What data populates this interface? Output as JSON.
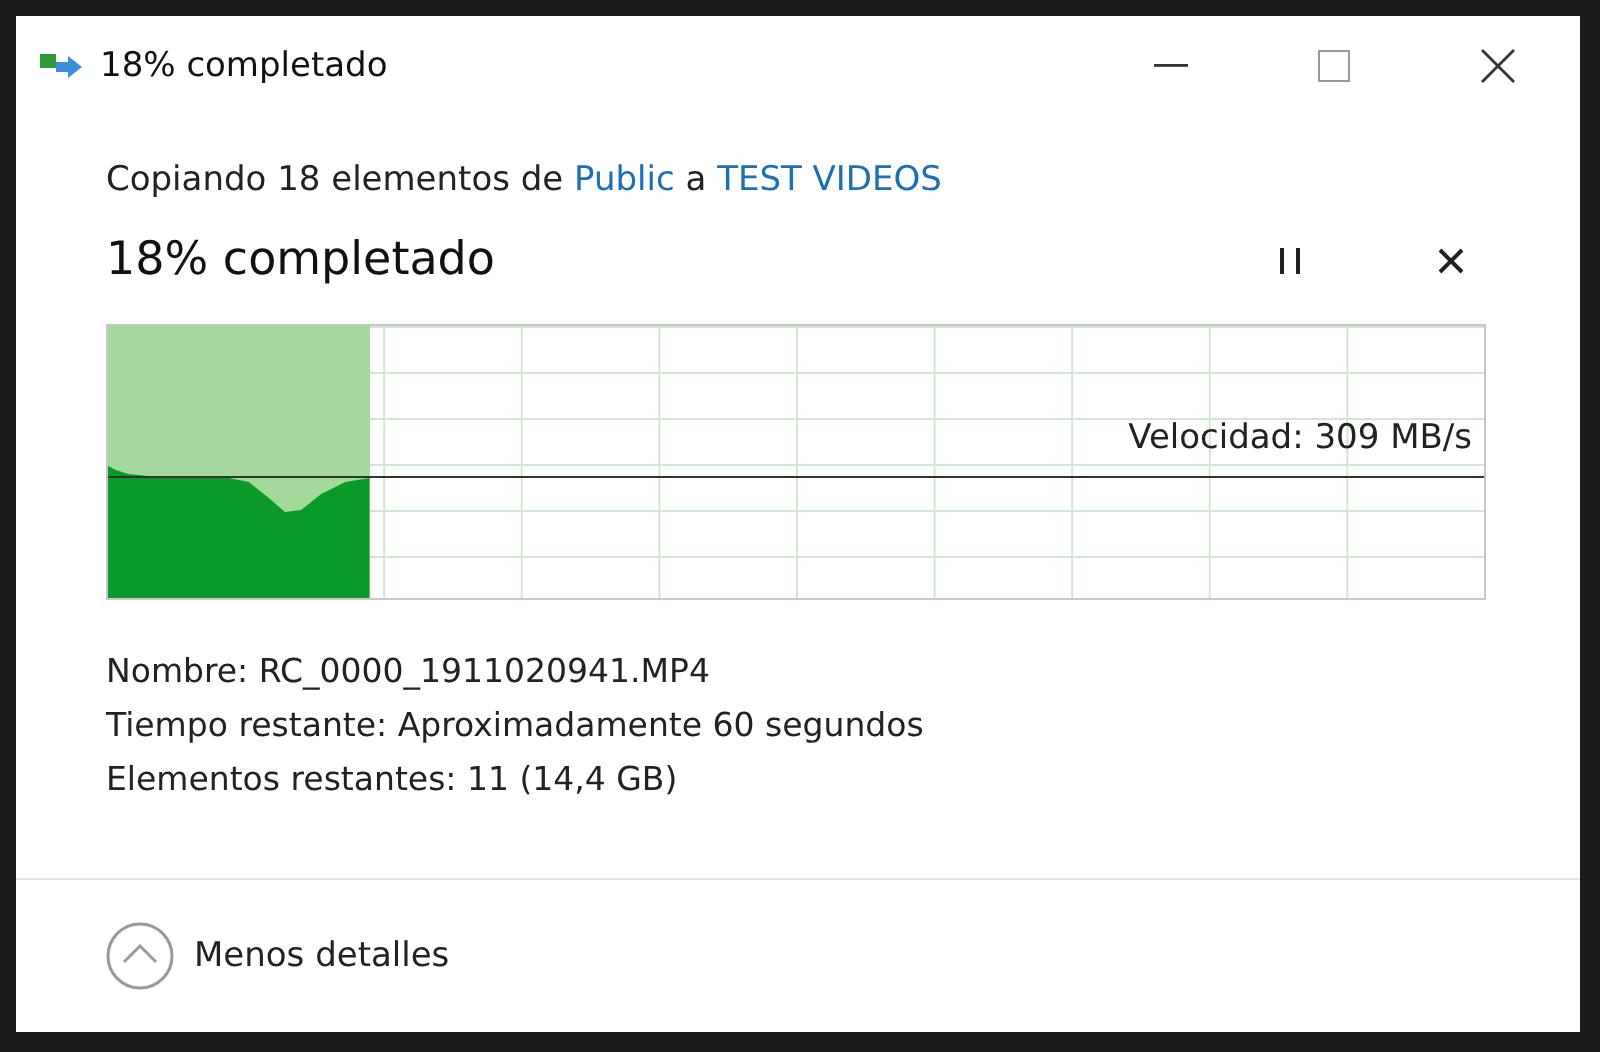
{
  "window": {
    "title": "18% completado",
    "controls": [
      {
        "kind": "minimize"
      },
      {
        "kind": "maximize"
      },
      {
        "kind": "close"
      }
    ]
  },
  "summary": [
    {
      "kind": "plain",
      "text": "Copiando 18 elementos de"
    },
    {
      "kind": "link",
      "text": "Public"
    },
    {
      "kind": "plain",
      "text": "a"
    },
    {
      "kind": "link",
      "text": "TEST VIDEOS"
    }
  ],
  "progress": {
    "heading": "18% completado",
    "actions": [
      {
        "kind": "pause"
      },
      {
        "kind": "cancel"
      }
    ]
  },
  "graph": {
    "level": 0.19,
    "speed": "Velocidad: 309 MB/s"
  },
  "details": [
    {
      "label": "Nombre:",
      "value": "RC_0000_1911020941.MP4"
    },
    {
      "label": "Tiempo restante:",
      "value": "Aproximadamente 60 segundos"
    },
    {
      "label": "Elementos restantes:",
      "value": "11 (14,4 GB)"
    }
  ],
  "footer": {
    "toggle": "Menos detalles"
  }
}
